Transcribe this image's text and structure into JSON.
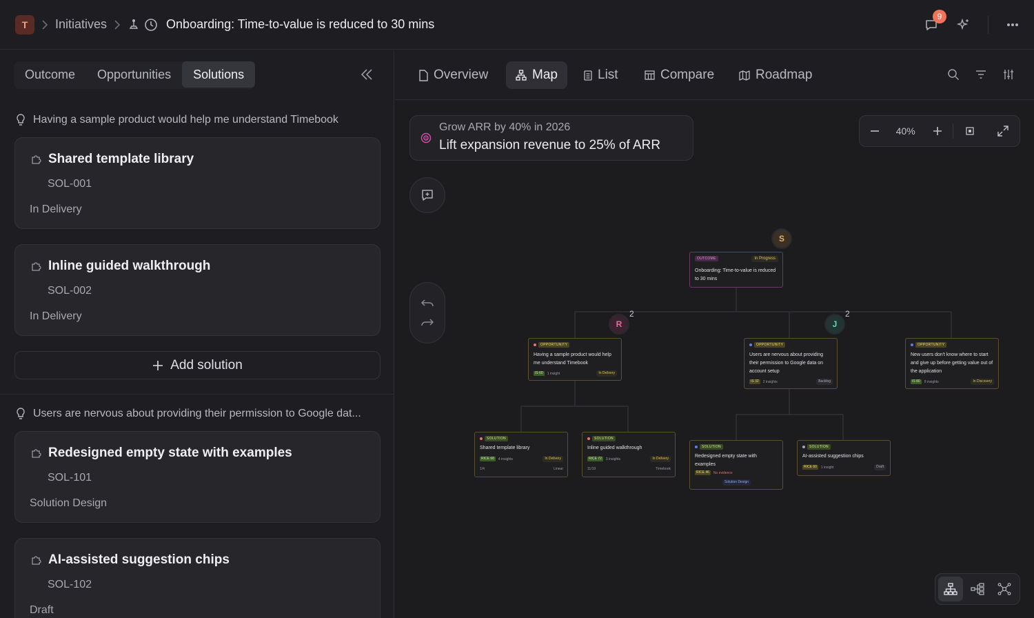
{
  "header": {
    "workspace_initial": "T",
    "breadcrumb": "Initiatives",
    "title": "Onboarding: Time-to-value is reduced to 30 mins",
    "notifications": "9"
  },
  "left": {
    "tabs": [
      "Outcome",
      "Opportunities",
      "Solutions"
    ],
    "groups": [
      {
        "heading": "Having a sample product would help me understand Timebook",
        "solutions": [
          {
            "title": "Shared template library",
            "id": "SOL-001",
            "status": "In Delivery"
          },
          {
            "title": "Inline guided walkthrough",
            "id": "SOL-002",
            "status": "In Delivery"
          }
        ],
        "add_label": "Add solution"
      },
      {
        "heading": "Users are nervous about providing their permission to Google dat...",
        "solutions": [
          {
            "title": "Redesigned empty state with examples",
            "id": "SOL-101",
            "status": "Solution Design"
          },
          {
            "title": "AI-assisted suggestion chips",
            "id": "SOL-102",
            "status": "Draft"
          }
        ]
      }
    ]
  },
  "right": {
    "tabs": [
      "Overview",
      "Map",
      "List",
      "Compare",
      "Roadmap"
    ],
    "active_tab": "Map",
    "goal": {
      "subtitle": "Grow ARR by 40% in 2026",
      "title": "Lift expansion revenue to 25% of ARR"
    },
    "zoom": "40%"
  },
  "map": {
    "outcome": {
      "type": "OUTCOME",
      "status": "In Progress",
      "title": "Onboarding: Time-to-value is reduced to 30 mins",
      "owner": "S"
    },
    "opportunities": [
      {
        "type": "OPPORTUNITY",
        "title": "Having a sample product would help me understand Timebook",
        "score": "IS 60",
        "insights": "1 insight",
        "status": "In Delivery",
        "owner": "R",
        "count": "2"
      },
      {
        "type": "OPPORTUNITY",
        "title": "Users are nervous about providing their permission to Google data on account setup",
        "score": "IS 32",
        "insights": "2 insights",
        "status": "Backlog",
        "owner": "J",
        "count": "2"
      },
      {
        "type": "OPPORTUNITY",
        "title": "New users don't know where to start and give up before getting value out of the application",
        "score": "IS 80",
        "insights": "9 insights",
        "status": "In Discovery"
      }
    ],
    "solutions": [
      {
        "type": "SOLUTION",
        "title": "Shared template library",
        "score": "RICE 68",
        "insights": "4 insights",
        "status": "In Delivery",
        "progress": "1/4",
        "source": "Linear"
      },
      {
        "type": "SOLUTION",
        "title": "Inline guided walkthrough",
        "score": "RICE 72",
        "insights": "3 insights",
        "status": "In Delivery",
        "progress": "11/19",
        "source": "Timebook"
      },
      {
        "type": "SOLUTION",
        "title": "Redesigned empty state with examples",
        "score": "RICE 46",
        "insights": "No evidence",
        "status": "Solution Design"
      },
      {
        "type": "SOLUTION",
        "title": "AI-assisted suggestion chips",
        "score": "RICE 60",
        "insights": "1 insight",
        "status": "Draft"
      }
    ]
  },
  "colors": {
    "accent_pink": "#d04fa8",
    "badge": "#f0735a",
    "delivery_yellow": "#e0c050"
  }
}
